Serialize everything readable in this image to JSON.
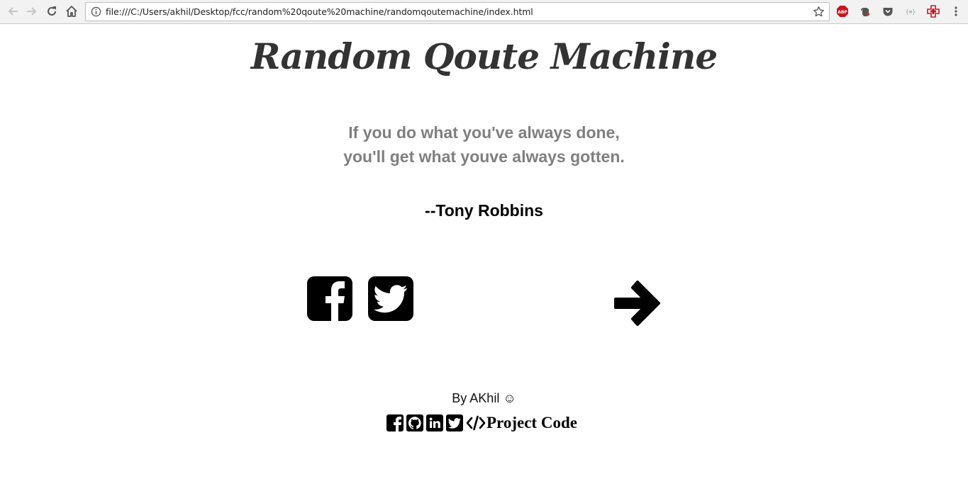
{
  "browser": {
    "url": "file:///C:/Users/akhil/Desktop/fcc/random%20qoute%20machine/randomqoutemachine/index.html",
    "icons": [
      "back-icon",
      "forward-icon",
      "reload-icon",
      "home-icon",
      "info-icon",
      "star-icon",
      "adblock-icon",
      "evernote-icon",
      "pocket-icon",
      "json-viewer-icon",
      "extension-red-icon",
      "menu-icon"
    ],
    "adblock_label": "ABP",
    "json_label": "{≡}"
  },
  "page": {
    "title": "Random Qoute Machine",
    "quote_line1": "If you do what you've always done,",
    "quote_line2": "you'll get what youve always gotten.",
    "author": "--Tony Robbins",
    "share_icons": [
      "facebook-icon",
      "twitter-icon"
    ],
    "next_icon": "arrow-right-icon"
  },
  "footer": {
    "byline": "By AKhil ☺",
    "social_icons": [
      "facebook-icon",
      "github-icon",
      "linkedin-icon",
      "twitter-icon"
    ],
    "code_icon": "code-icon",
    "project_code_label": "Project Code"
  },
  "colors": {
    "title": "#333333",
    "quote": "#7f7f7f",
    "author": "#000000",
    "toolbar_bg": "#f2f2f2"
  }
}
